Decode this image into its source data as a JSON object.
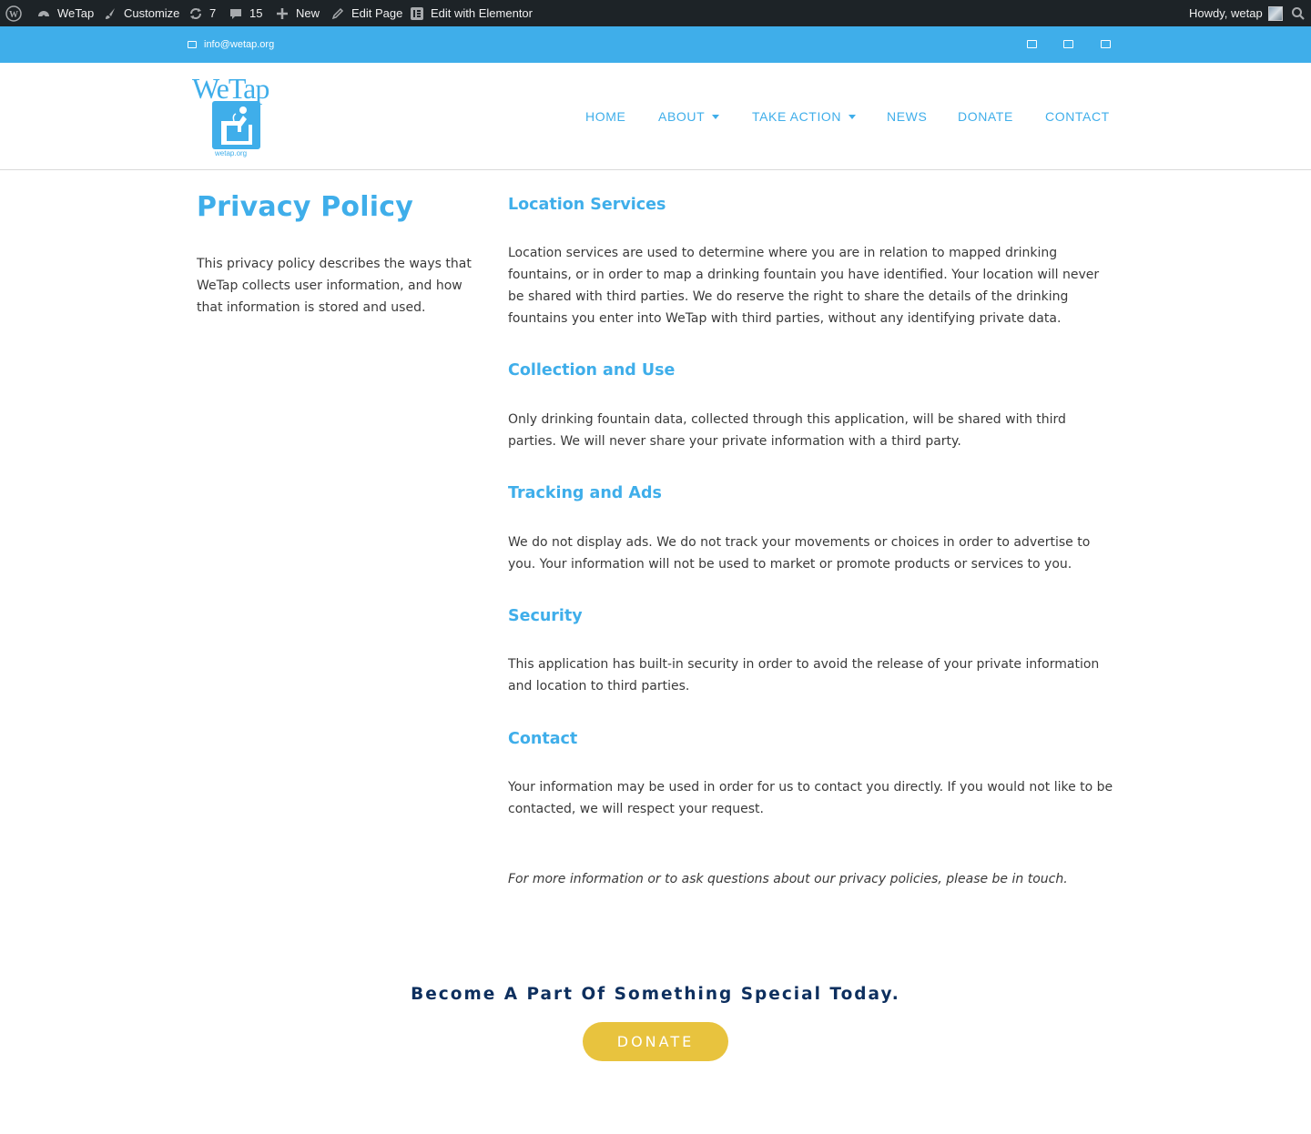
{
  "admin_bar": {
    "site_name": "WeTap",
    "customize": "Customize",
    "updates_count": "7",
    "comments_count": "15",
    "new_label": "New",
    "edit_page": "Edit Page",
    "edit_elementor": "Edit with Elementor",
    "howdy": "Howdy, wetap"
  },
  "topbar": {
    "email": "info@wetap.org",
    "color": "#3faeea"
  },
  "header": {
    "logo_text": "WeTap",
    "logo_url_text": "wetap.org",
    "nav": [
      {
        "label": "HOME"
      },
      {
        "label": "ABOUT"
      },
      {
        "label": "TAKE ACTION"
      },
      {
        "label": "NEWS"
      },
      {
        "label": "DONATE"
      },
      {
        "label": "CONTACT"
      }
    ]
  },
  "content": {
    "title": "Privacy Policy",
    "intro": "This privacy policy describes the ways that WeTap collects user information, and how that information is stored and used.",
    "sections": [
      {
        "title": "Location Services",
        "text": "Location services are used to determine where you are in relation to mapped drinking fountains, or in order to map a drinking fountain you have identified. Your location will never be shared with third parties. We do reserve the right to share the details of the drinking fountains you enter into WeTap with third parties, without any identifying private data."
      },
      {
        "title": "Collection and Use",
        "text": "Only drinking fountain data, collected through this application, will be shared with third parties. We will never share your private information with a third party."
      },
      {
        "title": "Tracking and Ads",
        "text": "We do not display ads. We do not track your movements or choices in order to advertise to you. Your information will not be used to market or promote products or services to you."
      },
      {
        "title": "Security",
        "text": "This application has built-in security in order to avoid the release of your private information and location to third parties."
      },
      {
        "title": "Contact",
        "text": "Your information may be used in order for us to contact you directly. If you would not like to be contacted, we will respect your request."
      }
    ],
    "note": "For more information or to ask questions about our privacy policies, please be in touch."
  },
  "cta": {
    "title": "Become A Part Of Something Special Today.",
    "button": "DONATE",
    "button_color": "#e8c33e"
  },
  "icons": [
    "wordpress-icon",
    "dashboard-icon",
    "brush-icon",
    "updates-icon",
    "comments-icon",
    "plus-icon",
    "pencil-icon",
    "elementor-icon",
    "search-icon",
    "mail-icon"
  ]
}
